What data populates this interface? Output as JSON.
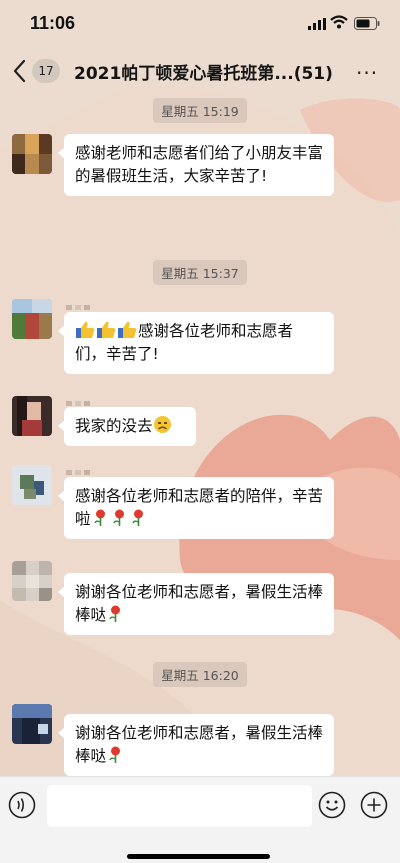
{
  "status_bar": {
    "time": "11:06"
  },
  "nav": {
    "back_label": "<",
    "unread_badge": "17",
    "title": "2021帕丁顿爱心暑托班第...",
    "member_count": "(51)",
    "more_label": "···"
  },
  "messages": [
    {
      "type": "timestamp",
      "text": "星期五 15:19"
    },
    {
      "type": "message",
      "avatar": "avatar-1",
      "text": "感谢老师和志愿者们给了小朋友丰富的暑假班生活，大家辛苦了!"
    },
    {
      "type": "timestamp",
      "text": "星期五 15:37"
    },
    {
      "type": "message",
      "avatar": "avatar-2",
      "emojis": [
        "thumbs-up-emoji",
        "thumbs-up-emoji",
        "thumbs-up-emoji"
      ],
      "text": "感谢各位老师和志愿者们，辛苦了!"
    },
    {
      "type": "message",
      "avatar": "avatar-3",
      "text": "我家的没去",
      "emojis_after": [
        "sad-face-emoji"
      ]
    },
    {
      "type": "message",
      "avatar": "avatar-4",
      "text": "感谢各位老师和志愿者的陪伴，辛苦啦",
      "emojis_after": [
        "rose-emoji",
        "rose-emoji",
        "rose-emoji"
      ]
    },
    {
      "type": "message",
      "avatar": "avatar-5",
      "text": "谢谢各位老师和志愿者，暑假生活棒棒哒",
      "emojis_after": [
        "rose-emoji"
      ]
    },
    {
      "type": "timestamp",
      "text": "星期五 16:20"
    },
    {
      "type": "message",
      "avatar": "avatar-6",
      "text": "谢谢各位老师和志愿者，暑假生活棒棒哒",
      "emojis_after": [
        "rose-emoji"
      ]
    }
  ],
  "input_bar": {
    "icons": [
      "voice-icon",
      "emoji-icon",
      "plus-icon"
    ],
    "input_value": ""
  },
  "colors": {
    "bubble": "#ffffff",
    "input_bar": "#f3f3f3",
    "background": "#ecdcd0",
    "heart": "#e89a86"
  }
}
